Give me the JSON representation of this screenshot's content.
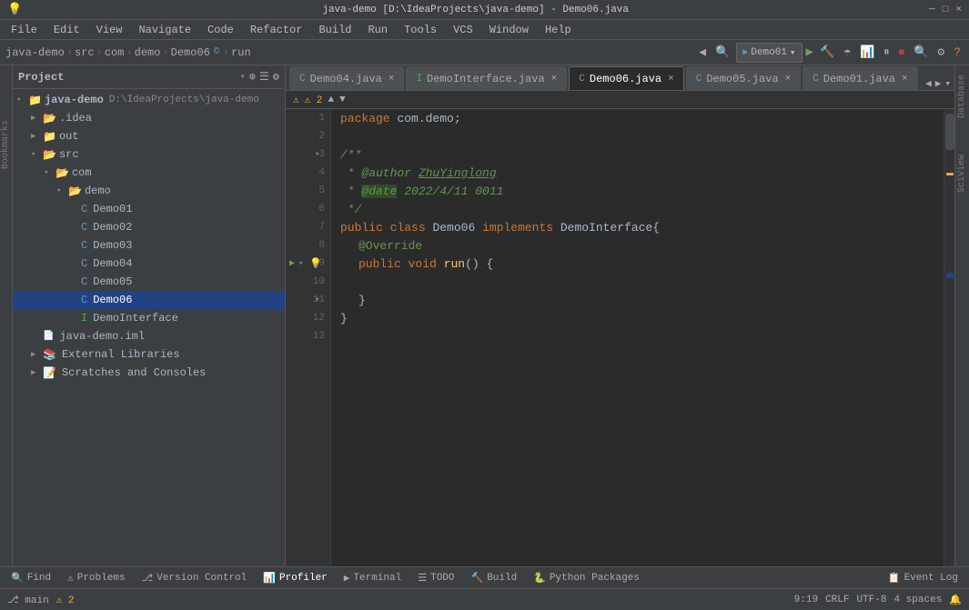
{
  "titlebar": {
    "title": "java-demo [D:\\IdeaProjects\\java-demo] - Demo06.java",
    "minimize": "─",
    "maximize": "□",
    "close": "×"
  },
  "menubar": {
    "items": [
      "File",
      "Edit",
      "View",
      "Navigate",
      "Code",
      "Refactor",
      "Build",
      "Run",
      "Tools",
      "VCS",
      "Window",
      "Help"
    ]
  },
  "navbar": {
    "project": "java-demo",
    "sep1": " › ",
    "src": "src",
    "sep2": " › ",
    "com": "com",
    "sep3": " › ",
    "demo": "demo",
    "sep4": " › ",
    "file": "Demo06",
    "sep5": " › ",
    "method": "run",
    "run_config": "Demo01",
    "chevron": "▾"
  },
  "tabs": [
    {
      "name": "Demo04.java",
      "type": "java",
      "color": "blue",
      "active": false
    },
    {
      "name": "DemoInterface.java",
      "type": "java",
      "color": "blue",
      "active": false
    },
    {
      "name": "Demo06.java",
      "type": "java",
      "color": "blue",
      "active": true
    },
    {
      "name": "Demo05.java",
      "type": "java",
      "color": "blue",
      "active": false
    },
    {
      "name": "Demo01.java",
      "type": "java",
      "color": "blue",
      "active": false
    }
  ],
  "editor": {
    "lines": [
      {
        "num": 1,
        "content": "package com.demo;"
      },
      {
        "num": 2,
        "content": ""
      },
      {
        "num": 3,
        "content": "/**",
        "fold": true
      },
      {
        "num": 4,
        "content": " * @author ZhuYinglong"
      },
      {
        "num": 5,
        "content": " * @date 2022/4/11 0011"
      },
      {
        "num": 6,
        "content": " */"
      },
      {
        "num": 7,
        "content": "public class Demo06 implements DemoInterface{"
      },
      {
        "num": 8,
        "content": "    @Override"
      },
      {
        "num": 9,
        "content": "    public void run() {",
        "run": true,
        "fold": true,
        "bulb": true
      },
      {
        "num": 10,
        "content": ""
      },
      {
        "num": 11,
        "content": "    }",
        "fold": true
      },
      {
        "num": 12,
        "content": "}"
      },
      {
        "num": 13,
        "content": ""
      }
    ]
  },
  "project_panel": {
    "title": "Project",
    "root": {
      "name": "java-demo",
      "path": "D:\\IdeaProjects\\java-demo",
      "children": [
        {
          "name": ".idea",
          "type": "folder",
          "indent": 1
        },
        {
          "name": "out",
          "type": "folder",
          "indent": 1,
          "expanded": false
        },
        {
          "name": "src",
          "type": "folder",
          "indent": 1,
          "expanded": true
        },
        {
          "name": "com",
          "type": "folder",
          "indent": 2,
          "expanded": true
        },
        {
          "name": "demo",
          "type": "folder",
          "indent": 3,
          "expanded": true
        },
        {
          "name": "Demo01",
          "type": "java-blue",
          "indent": 4
        },
        {
          "name": "Demo02",
          "type": "java-blue",
          "indent": 4
        },
        {
          "name": "Demo03",
          "type": "java-blue",
          "indent": 4
        },
        {
          "name": "Demo04",
          "type": "java-blue",
          "indent": 4
        },
        {
          "name": "Demo05",
          "type": "java-blue",
          "indent": 4
        },
        {
          "name": "Demo06",
          "type": "java-blue",
          "indent": 4,
          "selected": true
        },
        {
          "name": "DemoInterface",
          "type": "java-green",
          "indent": 4
        }
      ]
    },
    "extra": [
      {
        "name": "java-demo.iml",
        "type": "iml",
        "indent": 1
      },
      {
        "name": "External Libraries",
        "type": "folder",
        "indent": 1
      },
      {
        "name": "Scratches and Consoles",
        "type": "folder",
        "indent": 1
      }
    ]
  },
  "statusbar": {
    "warnings": "⚠ 2",
    "line_col": "9:19",
    "encoding": "CRLF",
    "charset": "UTF-8",
    "indent": "4 spaces"
  },
  "bottomtools": {
    "items": [
      {
        "icon": "🔍",
        "label": "Find"
      },
      {
        "icon": "⚠",
        "label": "Problems"
      },
      {
        "icon": "⎇",
        "label": "Version Control"
      },
      {
        "icon": "📊",
        "label": "Profiler"
      },
      {
        "icon": "▶",
        "label": "Terminal"
      },
      {
        "icon": "☰",
        "label": "TODO"
      },
      {
        "icon": "🔨",
        "label": "Build"
      },
      {
        "icon": "🐍",
        "label": "Python Packages"
      },
      {
        "icon": "📋",
        "label": "Event Log"
      }
    ]
  },
  "right_panel": {
    "database": "Database",
    "scview": "SciView"
  }
}
